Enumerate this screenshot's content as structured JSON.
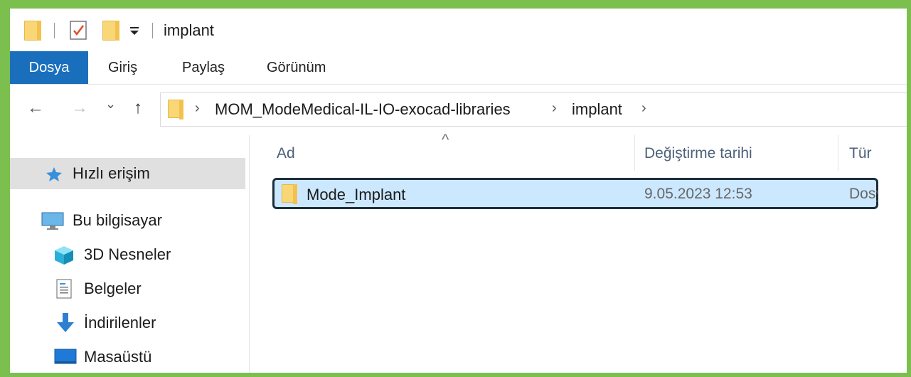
{
  "window": {
    "title": "implant"
  },
  "ribbon": {
    "tabs": [
      "Dosya",
      "Giriş",
      "Paylaş",
      "Görünüm"
    ]
  },
  "nav": {
    "back": "←",
    "forward": "→",
    "recent": "⌄",
    "up": "↑",
    "breadcrumb": [
      "MOM_ModeMedical-IL-IO-exocad-libraries",
      "implant"
    ]
  },
  "sidebar": {
    "items": [
      {
        "label": "Hızlı erişim",
        "icon": "star-icon"
      },
      {
        "label": "Bu bilgisayar",
        "icon": "computer-icon"
      },
      {
        "label": "3D Nesneler",
        "icon": "cube-icon"
      },
      {
        "label": "Belgeler",
        "icon": "document-icon"
      },
      {
        "label": "İndirilenler",
        "icon": "download-arrow-icon"
      },
      {
        "label": "Masaüstü",
        "icon": "desktop-icon"
      }
    ]
  },
  "columns": [
    "Ad",
    "Değiştirme tarihi",
    "Tür"
  ],
  "files": [
    {
      "name": "Mode_Implant",
      "modified": "9.05.2023 12:53",
      "type": "Dosya klasörü"
    }
  ],
  "colors": {
    "accent": "#1a6fbd",
    "selection": "#cce8ff",
    "frame": "#7bbf4e"
  }
}
